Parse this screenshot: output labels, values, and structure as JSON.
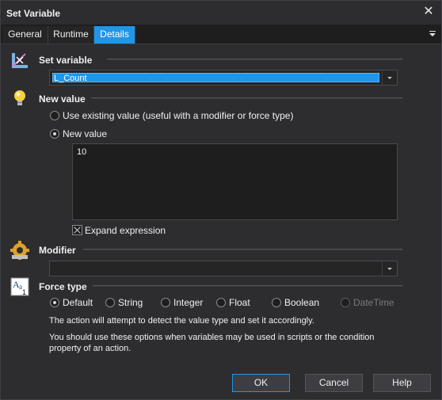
{
  "window": {
    "title": "Set Variable",
    "close_glyph": "✕"
  },
  "tabs": [
    {
      "label": "General"
    },
    {
      "label": "Runtime"
    },
    {
      "label": "Details",
      "active": true
    }
  ],
  "set_variable": {
    "header": "Set variable",
    "icon": "set-variable-icon",
    "selected_value": "L_Count"
  },
  "new_value": {
    "header": "New value",
    "icon": "lightbulb-icon",
    "option_existing": "Use existing value (useful with a modifier or force type)",
    "option_new": "New value",
    "selected_option": "New value",
    "value_text": "10",
    "expand_label": "Expand expression",
    "expand_checked": true
  },
  "modifier": {
    "header": "Modifier",
    "icon": "gear-icon",
    "selected_value": ""
  },
  "force_type": {
    "header": "Force type",
    "icon": "type-icon",
    "options": [
      "Default",
      "String",
      "Integer",
      "Float",
      "Boolean",
      "DateTime"
    ],
    "selected": "Default",
    "disabled": [
      "DateTime"
    ],
    "description_1": "The action will attempt to detect the value type and set it accordingly.",
    "description_2": "You should use these options when variables may be used in scripts or the condition property of an action."
  },
  "buttons": {
    "ok": "OK",
    "cancel": "Cancel",
    "help": "Help"
  },
  "colors": {
    "accent": "#1c97ea",
    "background": "#2d2d30"
  }
}
